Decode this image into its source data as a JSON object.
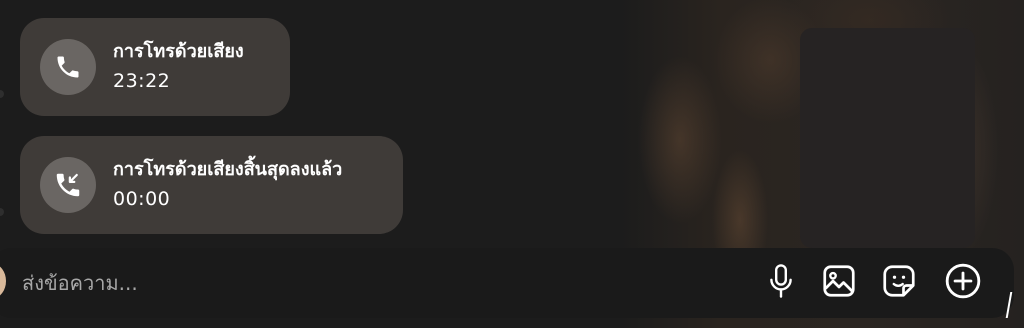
{
  "messages": [
    {
      "icon": "phone-icon",
      "title": "การโทรด้วยเสียง",
      "time": "23:22"
    },
    {
      "icon": "missed-call-icon",
      "title": "การโทรด้วยเสียงสิ้นสุดลงแล้ว",
      "time": "00:00"
    }
  ],
  "composer": {
    "placeholder": "ส่งข้อความ...",
    "tools": [
      "microphone-icon",
      "gallery-icon",
      "sticker-icon",
      "add-icon"
    ]
  },
  "colors": {
    "background": "#1c1c1c",
    "bubble": "#3f3b38",
    "icon_circle": "#6a6663",
    "text": "#ffffff",
    "placeholder": "#a8a8a8"
  }
}
